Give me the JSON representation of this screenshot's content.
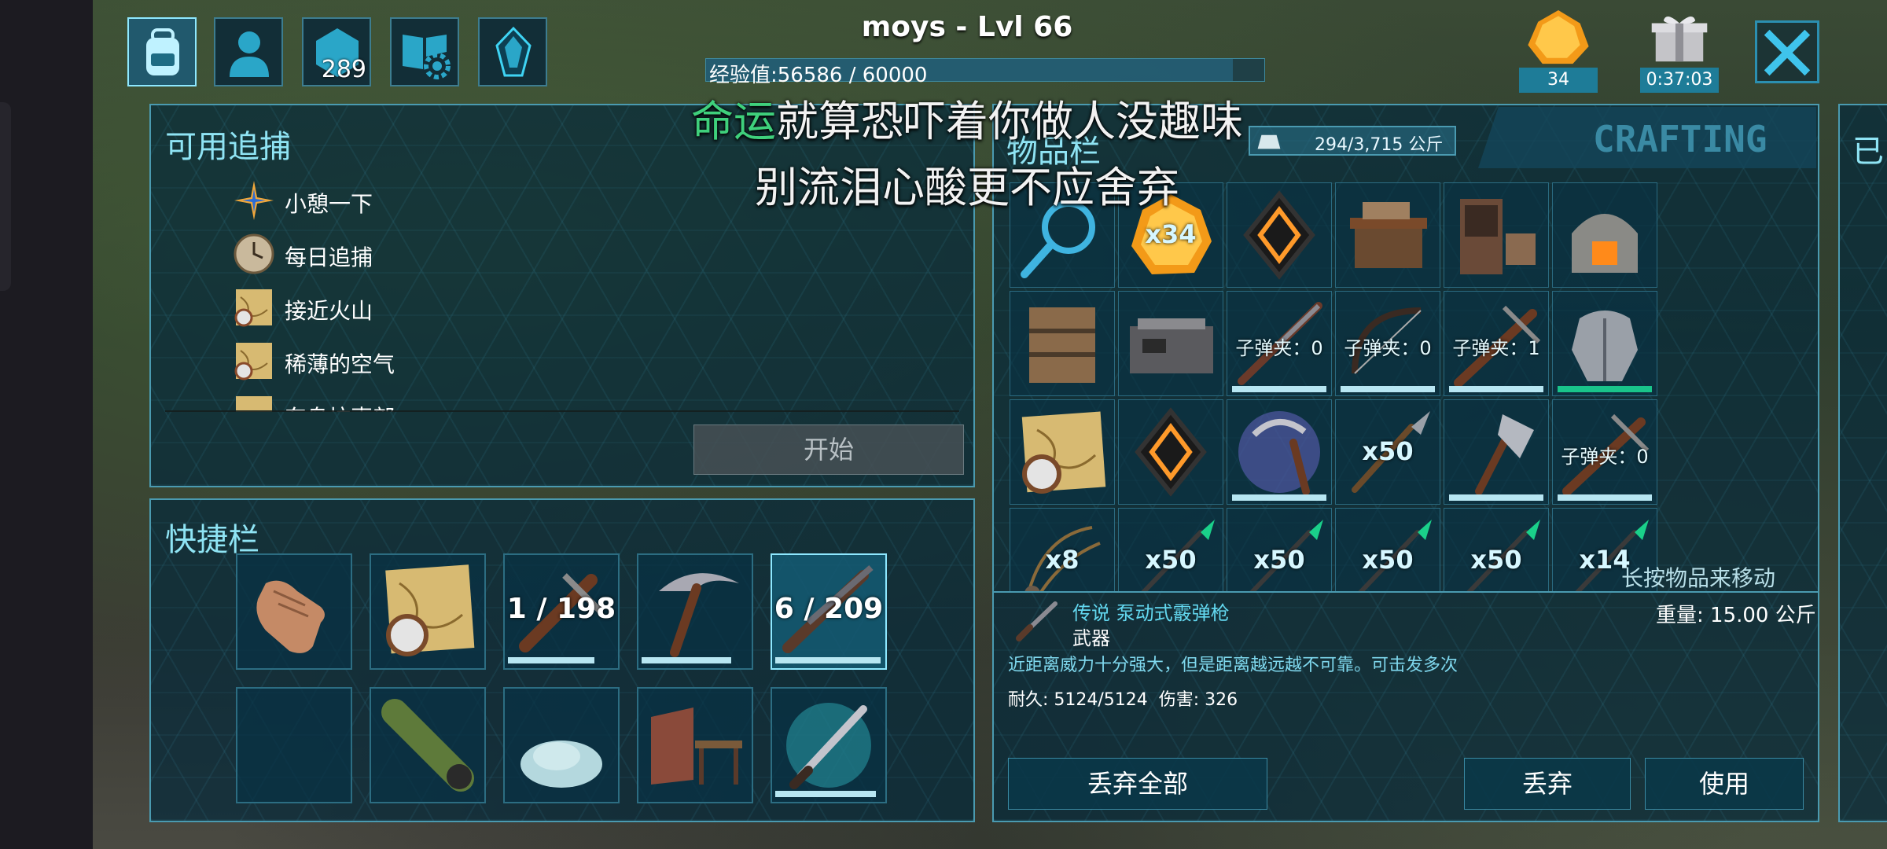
{
  "player": {
    "name": "moys - Lvl 66",
    "xp_label": "经验值:56586 / 60000",
    "xp_fraction": 0.943
  },
  "top_bar": {
    "engrams_count": "289",
    "amber_count": "34",
    "gift_timer": "0:37:03"
  },
  "lyrics": {
    "line1_highlight": "命运",
    "line1_rest": "就算恐吓着你做人没趣味",
    "line2": "别流泪心酸更不应舍弃"
  },
  "tracking": {
    "title": "可用追捕",
    "items": [
      {
        "label": "小憩一下",
        "icon": "compass-star-icon"
      },
      {
        "label": "每日追捕",
        "icon": "clock-icon"
      },
      {
        "label": "接近火山",
        "icon": "map-icon"
      },
      {
        "label": "稀薄的空气",
        "icon": "map-icon"
      },
      {
        "label": "东岛坑声部",
        "icon": "map-icon"
      }
    ],
    "start_button": "开始"
  },
  "hotbar": {
    "title": "快捷栏",
    "row1": [
      {
        "icon": "hand-icon",
        "qty": ""
      },
      {
        "icon": "map-icon",
        "qty": ""
      },
      {
        "icon": "crossbow-icon",
        "qty": "1 / 198",
        "durability": 0.8
      },
      {
        "icon": "pickaxe-icon",
        "qty": "",
        "durability": 0.82
      },
      {
        "icon": "shotgun-icon",
        "qty": "6 / 209",
        "durability": 0.95
      }
    ],
    "row2": [
      {
        "icon": "empty",
        "qty": ""
      },
      {
        "icon": "spyglass-icon",
        "qty": ""
      },
      {
        "icon": "stone-icon",
        "qty": ""
      },
      {
        "icon": "workbench-icon",
        "qty": ""
      },
      {
        "icon": "sword-icon",
        "qty": "",
        "durability": 0.9
      }
    ]
  },
  "inventory": {
    "title": "物品栏",
    "weight_capacity": "294/3,715 公斤",
    "crafting_tab": "CRAFTING",
    "hint": "长按物品来移动",
    "next_panel_char": "已",
    "rows": [
      [
        {
          "icon": "magnifier-icon",
          "label": ""
        },
        {
          "icon": "amber-icon",
          "label": "x34"
        },
        {
          "icon": "crystal-icon",
          "label": ""
        },
        {
          "icon": "crafting-table-icon",
          "label": ""
        },
        {
          "icon": "cabinet-icon",
          "label": ""
        },
        {
          "icon": "forge-icon",
          "label": ""
        }
      ],
      [
        {
          "icon": "shelf-icon",
          "label": ""
        },
        {
          "icon": "stove-icon",
          "label": ""
        },
        {
          "icon": "rifle-icon",
          "label": "子弹夹：0",
          "durability": 1
        },
        {
          "icon": "bow-icon",
          "label": "子弹夹：0",
          "durability": 1
        },
        {
          "icon": "crossbow-icon",
          "label": "子弹夹：1",
          "durability": 1
        },
        {
          "icon": "armor-icon",
          "label": "",
          "durability": 1,
          "green": true
        }
      ],
      [
        {
          "icon": "map-icon",
          "label": ""
        },
        {
          "icon": "crystal-icon",
          "label": ""
        },
        {
          "icon": "sickle-icon",
          "label": "",
          "durability": 1
        },
        {
          "icon": "spear-icon",
          "label": "x50"
        },
        {
          "icon": "hatchet-icon",
          "label": "",
          "durability": 1
        },
        {
          "icon": "crossbow-icon",
          "label": "子弹夹：0",
          "durability": 1
        }
      ],
      [
        {
          "icon": "bola-icon",
          "label": "x8"
        },
        {
          "icon": "arrow-icon",
          "label": "x50"
        },
        {
          "icon": "arrow-icon",
          "label": "x50"
        },
        {
          "icon": "arrow-icon",
          "label": "x50"
        },
        {
          "icon": "arrow-icon",
          "label": "x50"
        },
        {
          "icon": "arrow-icon",
          "label": "x14"
        }
      ]
    ]
  },
  "item_detail": {
    "name": "传说 泵动式霰弹枪",
    "type": "武器",
    "weight": "重量: 15.00 公斤",
    "description": "近距离威力十分强大，但是距离越远越不可靠。可击发多次",
    "stats": "耐久: 5124/5124  伤害: 326"
  },
  "actions": {
    "drop_all": "丢弃全部",
    "drop": "丢弃",
    "use": "使用"
  },
  "colors": {
    "panel_border": "#4a9ab0",
    "title_cyan": "#8fe4f4",
    "lyric_highlight": "#3fd07c",
    "badge_blue": "#1e7c98"
  }
}
